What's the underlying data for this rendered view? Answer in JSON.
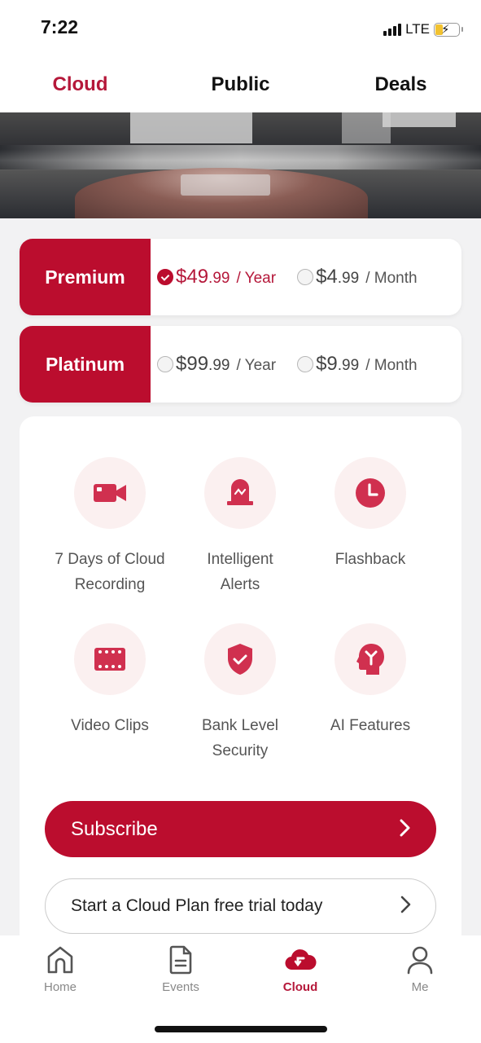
{
  "status_bar": {
    "time": "7:22",
    "network": "LTE"
  },
  "top_tabs": [
    {
      "label": "Cloud",
      "active": true
    },
    {
      "label": "Public",
      "active": false
    },
    {
      "label": "Deals",
      "active": false
    }
  ],
  "plans": [
    {
      "name": "Premium",
      "options": [
        {
          "price_int": "$49",
          "price_dec": ".99",
          "period": "/  Year",
          "selected": true
        },
        {
          "price_int": "$4",
          "price_dec": ".99",
          "period": "/  Month",
          "selected": false
        }
      ]
    },
    {
      "name": "Platinum",
      "options": [
        {
          "price_int": "$99",
          "price_dec": ".99",
          "period": "/  Year",
          "selected": false
        },
        {
          "price_int": "$9",
          "price_dec": ".99",
          "period": "/  Month",
          "selected": false
        }
      ]
    }
  ],
  "features": [
    {
      "icon": "video-camera-icon",
      "line1": "7 Days of Cloud",
      "line2": "Recording"
    },
    {
      "icon": "alarm-light-icon",
      "line1": "Intelligent",
      "line2": "Alerts"
    },
    {
      "icon": "clock-icon",
      "line1": "Flashback",
      "line2": ""
    },
    {
      "icon": "film-strip-icon",
      "line1": "Video Clips",
      "line2": ""
    },
    {
      "icon": "shield-check-icon",
      "line1": "Bank Level",
      "line2": "Security"
    },
    {
      "icon": "ai-head-icon",
      "line1": "AI Features",
      "line2": ""
    }
  ],
  "buttons": {
    "subscribe": "Subscribe",
    "trial": "Start a Cloud Plan free trial today"
  },
  "bottom_nav": [
    {
      "label": "Home",
      "icon": "home-icon",
      "active": false
    },
    {
      "label": "Events",
      "icon": "document-icon",
      "active": false
    },
    {
      "label": "Cloud",
      "icon": "cloud-icon",
      "active": true
    },
    {
      "label": "Me",
      "icon": "user-icon",
      "active": false
    }
  ],
  "colors": {
    "accent": "#bb0d2e",
    "accent_text": "#b5183a",
    "feature_bg": "#fbf0f0",
    "icon": "#d0304f"
  }
}
